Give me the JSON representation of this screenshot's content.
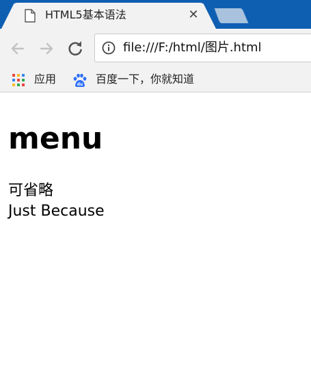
{
  "tab": {
    "title": "HTML5基本语法",
    "close_symbol": "✕"
  },
  "toolbar": {
    "url": "file:///F:/html/图片.html"
  },
  "bookmarks": [
    {
      "label": "应用",
      "icon": "apps-grid-icon"
    },
    {
      "label": "百度一下，你就知道",
      "icon": "baidu-paw-icon"
    }
  ],
  "page": {
    "heading": "menu",
    "lines": [
      "可省略",
      "Just Because"
    ]
  },
  "colors": {
    "tabstrip": "#0e5fb2",
    "toolbar": "#f2f2f2",
    "active_tab": "#f2f2f2",
    "inactive_tab": "#a9c3df"
  }
}
